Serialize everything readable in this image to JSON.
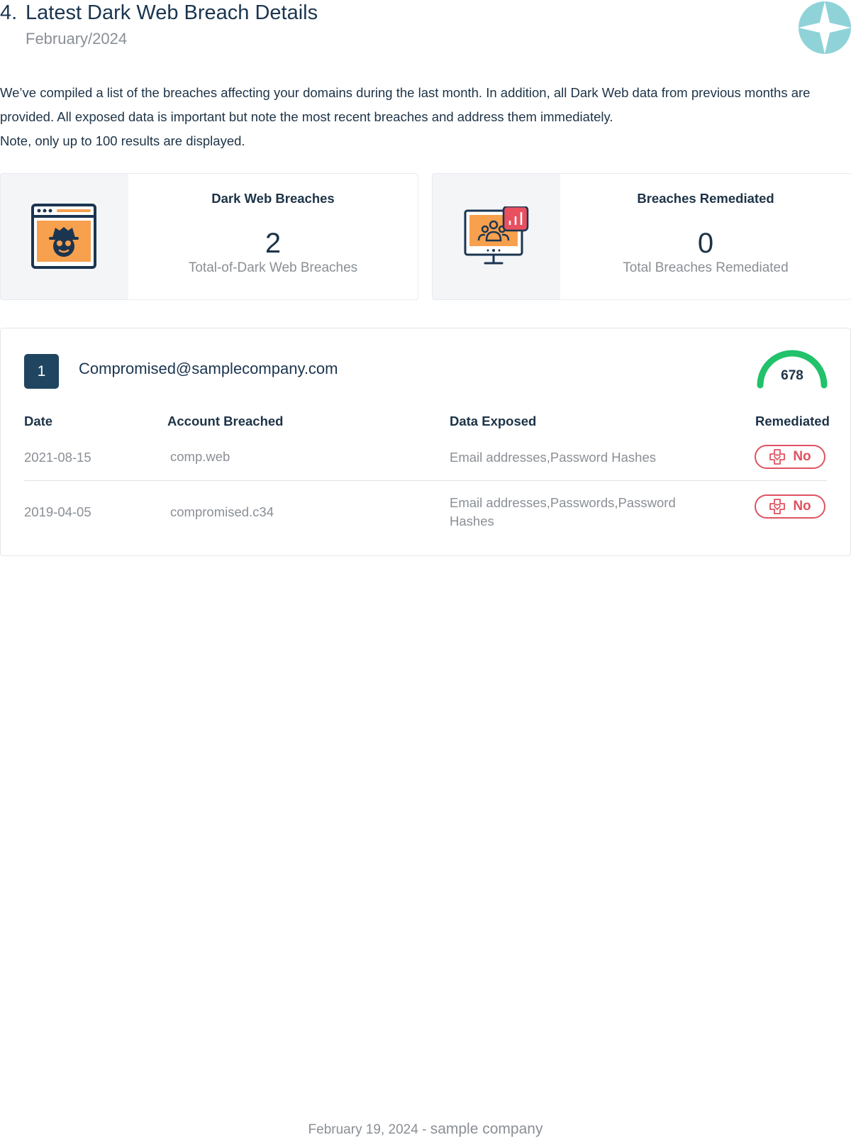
{
  "header": {
    "number": "4.",
    "title": "Latest Dark Web Breach Details",
    "subtitle": "February/2024",
    "logo_icon": "compass-star-logo-icon"
  },
  "intro": {
    "paragraph_1": "We’ve compiled a list of the breaches affecting your domains during the last month. In addition, all Dark Web data from previous months are provided. All exposed data is important but note the most recent breaches and address them immediately.",
    "paragraph_2": "Note, only up to 100 results are displayed."
  },
  "stats": [
    {
      "label": "Dark Web Breaches",
      "value": "2",
      "caption": "Total-of-Dark Web Breaches",
      "icon": "hacker-browser-icon"
    },
    {
      "label": "Breaches Remediated",
      "value": "0",
      "caption": "Total Breaches Remediated",
      "icon": "team-monitor-chart-icon"
    }
  ],
  "breach": {
    "index": "1",
    "email": "Compromised@samplecompany.com",
    "score": "678",
    "score_fraction": 0.68,
    "score_color": "#21c26a",
    "columns": {
      "date": "Date",
      "account": "Account Breached",
      "data": "Data Exposed",
      "remediated": "Remediated"
    },
    "rows": [
      {
        "date": "2021-08-15",
        "account": "comp.web",
        "data": "Email addresses,Password Hashes",
        "remediated": "No"
      },
      {
        "date": "2019-04-05",
        "account": "compromised.c34",
        "data": "Email addresses,Passwords,Password Hashes",
        "remediated": "No"
      }
    ]
  },
  "footer": {
    "date": "February 19, 2024 -",
    "company": "sample company"
  },
  "colors": {
    "accent": "#1f4560",
    "status_no": "#e05260",
    "icon_orange": "#f7a04e",
    "logo": "#8fd3d8"
  }
}
